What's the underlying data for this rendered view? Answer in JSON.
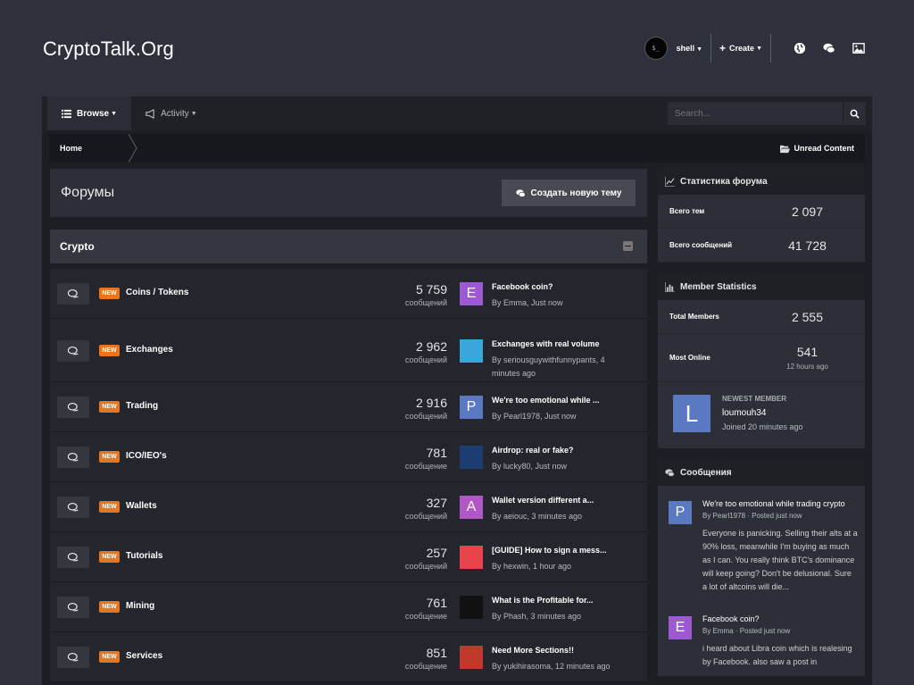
{
  "site": {
    "title": "CryptoTalk.Org"
  },
  "user": {
    "avatar_text": "$_",
    "name": "shell",
    "create_label": "Create"
  },
  "nav": {
    "browse": "Browse",
    "activity": "Activity",
    "search_placeholder": "Search..."
  },
  "breadcrumb": {
    "home": "Home",
    "unread": "Unread Content"
  },
  "page": {
    "title": "Форумы",
    "new_topic_button": "Создать новую тему"
  },
  "category": {
    "title": "Crypto"
  },
  "forums": [
    {
      "name": "Coins / Tokens",
      "badge": "NEW",
      "count": "5 759",
      "count_label": "сообщений",
      "avatar": "E",
      "avatar_color": "#9c59d1",
      "last_title": "Facebook coin?",
      "last_by": "By Emma, Just now"
    },
    {
      "name": "Exchanges",
      "badge": "NEW",
      "count": "2 962",
      "count_label": "сообщений",
      "avatar": "",
      "avatar_color": "#3aa6d9",
      "last_title": "Exchanges with real volume",
      "last_by": "By seriousguywithfunnypants, 4 minutes ago"
    },
    {
      "name": "Trading",
      "badge": "NEW",
      "count": "2 916",
      "count_label": "сообщений",
      "avatar": "P",
      "avatar_color": "#5a79c2",
      "last_title": "We're too emotional while ...",
      "last_by": "By Pearl1978, Just now"
    },
    {
      "name": "ICO/IEO's",
      "badge": "NEW",
      "count": "781",
      "count_label": "сообщение",
      "avatar": "",
      "avatar_color": "#1c3b6e",
      "last_title": "Airdrop: real or fake?",
      "last_by": "By lucky80, Just now"
    },
    {
      "name": "Wallets",
      "badge": "NEW",
      "count": "327",
      "count_label": "сообщений",
      "avatar": "A",
      "avatar_color": "#b056c6",
      "last_title": "Wallet version different a...",
      "last_by": "By aeiouc, 3 minutes ago"
    },
    {
      "name": "Tutorials",
      "badge": "NEW",
      "count": "257",
      "count_label": "сообщений",
      "avatar": "",
      "avatar_color": "#e9434b",
      "last_title": "[GUIDE] How to sign a mess...",
      "last_by": "By hexwin, 1 hour ago"
    },
    {
      "name": "Mining",
      "badge": "NEW",
      "count": "761",
      "count_label": "сообщение",
      "avatar": "",
      "avatar_color": "#111111",
      "last_title": "What is the Profitable for...",
      "last_by": "By Phash, 3 minutes ago"
    },
    {
      "name": "Services",
      "badge": "NEW",
      "count": "851",
      "count_label": "сообщение",
      "avatar": "",
      "avatar_color": "#c0392b",
      "last_title": "Need More Sections!!",
      "last_by": "By yukihirasoma, 12 minutes ago"
    }
  ],
  "forum_stats": {
    "title": "Статистика форума",
    "topics_label": "Всего тем",
    "topics_value": "2 097",
    "posts_label": "Всего сообщений",
    "posts_value": "41 728"
  },
  "member_stats": {
    "title": "Member Statistics",
    "total_label": "Total Members",
    "total_value": "2 555",
    "online_label": "Most Online",
    "online_value": "541",
    "online_sub": "12 hours ago",
    "newest_label": "NEWEST MEMBER",
    "newest_name": "loumouh34",
    "newest_joined": "Joined 20 minutes ago",
    "newest_avatar": "L"
  },
  "posts_block": {
    "title": "Сообщения",
    "items": [
      {
        "avatar": "P",
        "avatar_color": "#5a79c2",
        "title": "We're too emotional while trading crypto",
        "meta": "By Pearl1978 · Posted just now",
        "body": "Everyone is panicking. Selling their alts at a 90% loss, meanwhile I'm buying as much as I can. You really think BTC's dominance will keep going? Don't be delusional. Sure a lot of altcoins will die..."
      },
      {
        "avatar": "E",
        "avatar_color": "#9c59d1",
        "title": "Facebook coin?",
        "meta": "By Emma · Posted just now",
        "body": "i heard about Libra coin which is realesing by Facebook. also saw a post in"
      }
    ]
  },
  "colors": {
    "accent_new": "#e8751d",
    "bg": "#2e313b"
  }
}
